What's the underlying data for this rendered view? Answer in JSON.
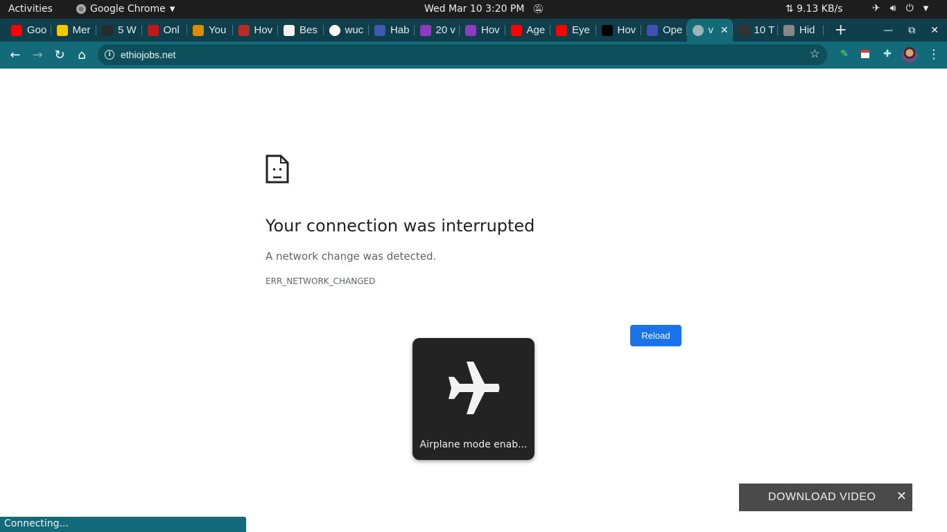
{
  "system_bar": {
    "activities": "Activities",
    "app_name": "Google Chrome",
    "datetime": "Wed Mar 10  3:20 PM",
    "network_speed": "⇅ 9.13 KB/s"
  },
  "tabs": [
    {
      "title": "Goo",
      "favicon": "youtube-icon",
      "color": "#ff0000"
    },
    {
      "title": "Mer",
      "favicon": "yellow-note-icon",
      "color": "#f2c800"
    },
    {
      "title": "5 W",
      "favicon": "ie-icon",
      "color": "#2a2a2a"
    },
    {
      "title": "Onl",
      "favicon": "udemy-icon",
      "color": "#c01818"
    },
    {
      "title": "You",
      "favicon": "triangle-logo-icon",
      "color": "#e08a00"
    },
    {
      "title": "Hov",
      "favicon": "quora-icon",
      "color": "#b92b27"
    },
    {
      "title": "Bes",
      "favicon": "k-logo-icon",
      "color": "#f1f1f1"
    },
    {
      "title": "wuc",
      "favicon": "google-icon",
      "color": "#ffffff"
    },
    {
      "title": "Hab",
      "favicon": "blue-circle-icon",
      "color": "#3b5ab0"
    },
    {
      "title": "20 v",
      "favicon": "purple-e-icon",
      "color": "#8d3bbf"
    },
    {
      "title": "Hov",
      "favicon": "purple-e-icon",
      "color": "#8d3bbf"
    },
    {
      "title": "Age",
      "favicon": "youtube-icon",
      "color": "#ff0000"
    },
    {
      "title": "Eye",
      "favicon": "youtube-icon",
      "color": "#ff0000"
    },
    {
      "title": "Hov",
      "favicon": "dev-icon",
      "color": "#000000"
    },
    {
      "title": "Ope",
      "favicon": "blue-e-icon",
      "color": "#3f51b5"
    },
    {
      "title": "v",
      "favicon": "globe-icon",
      "color": "#9bb4ba",
      "active": true
    },
    {
      "title": "10 T",
      "favicon": "dark-image-icon",
      "color": "#333333"
    },
    {
      "title": "Hid",
      "favicon": "owl-icon",
      "color": "#888888"
    }
  ],
  "address_bar": {
    "url": "ethiojobs.net"
  },
  "error_page": {
    "title": "Your connection was interrupted",
    "description": "A network change was detected.",
    "code": "ERR_NETWORK_CHANGED",
    "reload_label": "Reload"
  },
  "osd": {
    "text": "Airplane mode enab..."
  },
  "download_bar": {
    "label": "DOWNLOAD VIDEO"
  },
  "status_bubble": {
    "text": "Connecting..."
  }
}
